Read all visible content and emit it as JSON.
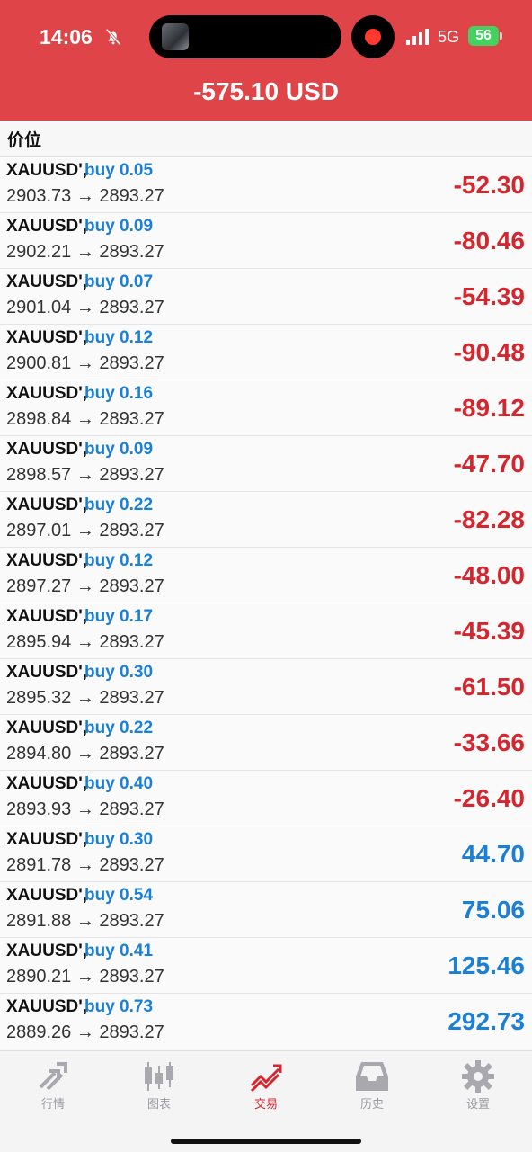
{
  "status_bar": {
    "time": "14:06",
    "network": "5G",
    "battery": "56"
  },
  "account": {
    "balance_text": "-575.10 USD"
  },
  "section": {
    "label": "价位"
  },
  "positions": [
    {
      "symbol": "XAUUSD',",
      "side": "buy 0.05",
      "prices": "2903.73 → 2893.27",
      "pnl": "-52.30",
      "pnl_class": "neg"
    },
    {
      "symbol": "XAUUSD',",
      "side": "buy 0.09",
      "prices": "2902.21 → 2893.27",
      "pnl": "-80.46",
      "pnl_class": "neg"
    },
    {
      "symbol": "XAUUSD',",
      "side": "buy 0.07",
      "prices": "2901.04 → 2893.27",
      "pnl": "-54.39",
      "pnl_class": "neg"
    },
    {
      "symbol": "XAUUSD',",
      "side": "buy 0.12",
      "prices": "2900.81 → 2893.27",
      "pnl": "-90.48",
      "pnl_class": "neg"
    },
    {
      "symbol": "XAUUSD',",
      "side": "buy 0.16",
      "prices": "2898.84 → 2893.27",
      "pnl": "-89.12",
      "pnl_class": "neg"
    },
    {
      "symbol": "XAUUSD',",
      "side": "buy 0.09",
      "prices": "2898.57 → 2893.27",
      "pnl": "-47.70",
      "pnl_class": "neg"
    },
    {
      "symbol": "XAUUSD',",
      "side": "buy 0.22",
      "prices": "2897.01 → 2893.27",
      "pnl": "-82.28",
      "pnl_class": "neg"
    },
    {
      "symbol": "XAUUSD',",
      "side": "buy 0.12",
      "prices": "2897.27 → 2893.27",
      "pnl": "-48.00",
      "pnl_class": "neg"
    },
    {
      "symbol": "XAUUSD',",
      "side": "buy 0.17",
      "prices": "2895.94 → 2893.27",
      "pnl": "-45.39",
      "pnl_class": "neg"
    },
    {
      "symbol": "XAUUSD',",
      "side": "buy 0.30",
      "prices": "2895.32 → 2893.27",
      "pnl": "-61.50",
      "pnl_class": "neg"
    },
    {
      "symbol": "XAUUSD',",
      "side": "buy 0.22",
      "prices": "2894.80 → 2893.27",
      "pnl": "-33.66",
      "pnl_class": "neg"
    },
    {
      "symbol": "XAUUSD',",
      "side": "buy 0.40",
      "prices": "2893.93 → 2893.27",
      "pnl": "-26.40",
      "pnl_class": "neg"
    },
    {
      "symbol": "XAUUSD',",
      "side": "buy 0.30",
      "prices": "2891.78 → 2893.27",
      "pnl": "44.70",
      "pnl_class": "pos"
    },
    {
      "symbol": "XAUUSD',",
      "side": "buy 0.54",
      "prices": "2891.88 → 2893.27",
      "pnl": "75.06",
      "pnl_class": "pos"
    },
    {
      "symbol": "XAUUSD',",
      "side": "buy 0.41",
      "prices": "2890.21 → 2893.27",
      "pnl": "125.46",
      "pnl_class": "pos"
    },
    {
      "symbol": "XAUUSD',",
      "side": "buy 0.73",
      "prices": "2889.26 → 2893.27",
      "pnl": "292.73",
      "pnl_class": "pos"
    }
  ],
  "tabs": [
    {
      "label": "行情",
      "icon": "quotes-arrows-icon"
    },
    {
      "label": "图表",
      "icon": "candlestick-chart-icon"
    },
    {
      "label": "交易",
      "icon": "trade-trend-icon",
      "active": true
    },
    {
      "label": "历史",
      "icon": "history-inbox-icon"
    },
    {
      "label": "设置",
      "icon": "gear-icon"
    }
  ],
  "colors": {
    "header_red": "#df4548",
    "loss_red": "#d4262e",
    "profit_blue": "#1c7fd6"
  }
}
